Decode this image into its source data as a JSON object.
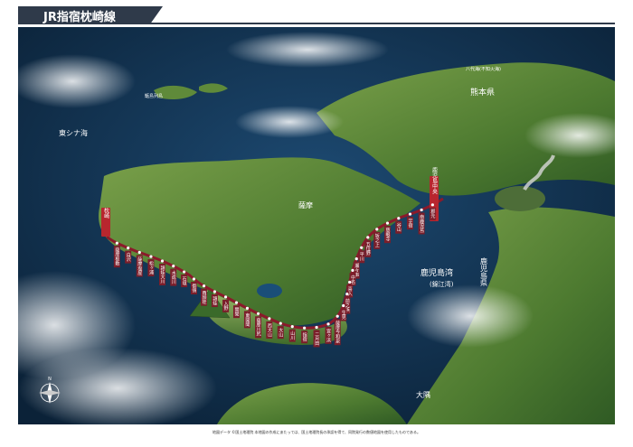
{
  "header": {
    "title": "JR指宿枕崎線"
  },
  "map": {
    "sea_labels": {
      "east_china_sea": "東シナ海",
      "kagoshima_bay": "鹿児島湾",
      "kagoshima_bay_alt": "(錦江湾)"
    },
    "region_labels": {
      "kumamoto": "熊本県",
      "kagoshima": "鹿児島県",
      "koshiki": "甑島列島",
      "satsuma": "薩摩",
      "yatsushiro": "八代海(不知火海)",
      "osumi": "大隅"
    },
    "stations": [
      "鹿児島中央",
      "郡元",
      "南鹿児島",
      "宇宿",
      "谷山",
      "慈眼寺",
      "坂之上",
      "五位野",
      "平川",
      "瀬々串",
      "中名",
      "喜入",
      "前之浜",
      "生見",
      "薩摩今和泉",
      "宮ヶ浜",
      "二月田",
      "指宿",
      "山川",
      "大山",
      "西大山",
      "薩摩川尻",
      "東開聞",
      "開聞",
      "入野",
      "頴娃",
      "西頴娃",
      "御領",
      "石垣",
      "水成川",
      "頴娃大川",
      "松ヶ浦",
      "薩摩塩屋",
      "白沢",
      "薩摩板敷",
      "枕崎"
    ],
    "terminal_labels": {
      "start": "鹿児島中央",
      "end": "枕崎"
    },
    "colors": {
      "route": "#8b1a2b",
      "sea": "#133a5e",
      "land": "#5f8a3a",
      "title_bg": "#2f3a4a"
    },
    "icons": [
      "compass-rose-icon",
      "volcano-smoke-icon"
    ]
  },
  "footer": {
    "credits": "地図データ ©国土地理院  本地図の作成にあたっては、国土地理院長の承認を得て、同院発行の数値地図を使用したものである。"
  }
}
